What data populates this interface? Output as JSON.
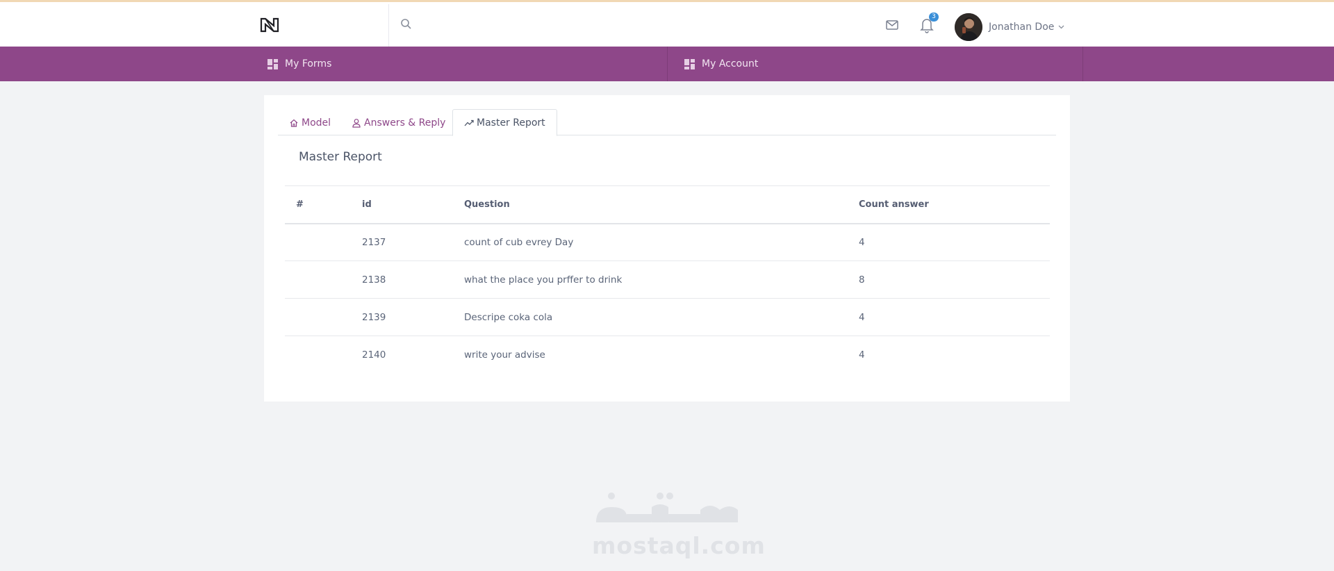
{
  "header": {
    "user_name": "Jonathan Doe",
    "notification_count": "3",
    "icons": [
      "brand-logo",
      "search-icon",
      "mail-icon",
      "bell-icon",
      "chevron-down-icon"
    ]
  },
  "nav": {
    "items": [
      {
        "label": "My Forms",
        "icon": "dashboard-icon"
      },
      {
        "label": "My Account",
        "icon": "dashboard-icon"
      }
    ]
  },
  "tabs": [
    {
      "label": "Model",
      "icon": "home-icon",
      "active": false
    },
    {
      "label": "Answers & Reply",
      "icon": "user-icon",
      "active": false
    },
    {
      "label": "Master Report",
      "icon": "chart-line-icon",
      "active": true
    }
  ],
  "report": {
    "title": "Master Report",
    "columns": [
      "#",
      "id",
      "Question",
      "Count answer"
    ],
    "rows": [
      {
        "num": "",
        "id": "2137",
        "question": "count of cub evrey Day",
        "count": "4"
      },
      {
        "num": "",
        "id": "2138",
        "question": "what the place you prffer to drink",
        "count": "8"
      },
      {
        "num": "",
        "id": "2139",
        "question": "Descripe coka cola",
        "count": "4"
      },
      {
        "num": "",
        "id": "2140",
        "question": "write your advise",
        "count": "4"
      }
    ]
  },
  "watermark": {
    "arabic": "مستقل",
    "latin": "mostaql.com"
  },
  "colors": {
    "brand_purple": "#8e4789",
    "background": "#f2f3f5",
    "badge_blue": "#3a8fd8"
  }
}
